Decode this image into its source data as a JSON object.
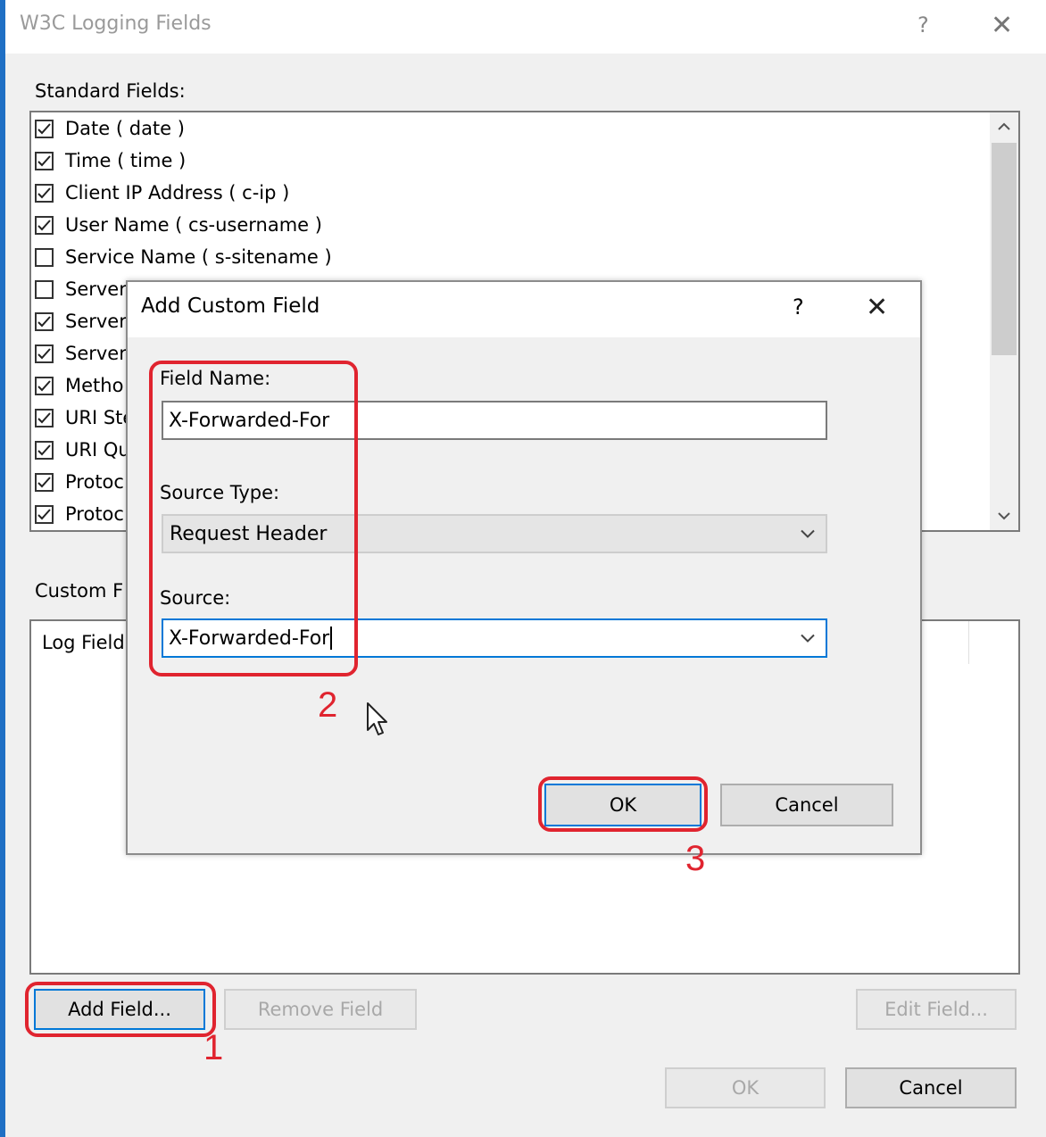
{
  "window": {
    "title": "W3C Logging Fields",
    "help": "?",
    "close": "✕"
  },
  "standard_fields": {
    "label": "Standard Fields:",
    "items": [
      {
        "label": "Date ( date )",
        "checked": true
      },
      {
        "label": "Time ( time )",
        "checked": true
      },
      {
        "label": "Client IP Address ( c-ip )",
        "checked": true
      },
      {
        "label": "User Name ( cs-username )",
        "checked": true
      },
      {
        "label": "Service Name ( s-sitename )",
        "checked": false
      },
      {
        "label": "Server",
        "checked": false
      },
      {
        "label": "Server",
        "checked": true
      },
      {
        "label": "Server",
        "checked": true
      },
      {
        "label": "Metho",
        "checked": true
      },
      {
        "label": "URI Ste",
        "checked": true
      },
      {
        "label": "URI Qu",
        "checked": true
      },
      {
        "label": "Protoc",
        "checked": true
      },
      {
        "label": "Protoc",
        "checked": true
      }
    ]
  },
  "custom_fields": {
    "label": "Custom F",
    "column_header": "Log Field"
  },
  "buttons": {
    "add_field": "Add Field...",
    "remove_field": "Remove Field",
    "edit_field": "Edit Field...",
    "ok": "OK",
    "cancel": "Cancel"
  },
  "add_custom_field_dialog": {
    "title": "Add Custom Field",
    "help": "?",
    "close": "✕",
    "field_name_label": "Field Name:",
    "field_name_value": "X-Forwarded-For",
    "source_type_label": "Source Type:",
    "source_type_value": "Request Header",
    "source_label": "Source:",
    "source_value": "X-Forwarded-For",
    "ok_label": "OK",
    "cancel_label": "Cancel"
  },
  "annotations": {
    "step1": "1",
    "step2": "2",
    "step3": "3"
  },
  "colors": {
    "annotation_red": "#e0242f",
    "focus_blue": "#0078d7"
  }
}
